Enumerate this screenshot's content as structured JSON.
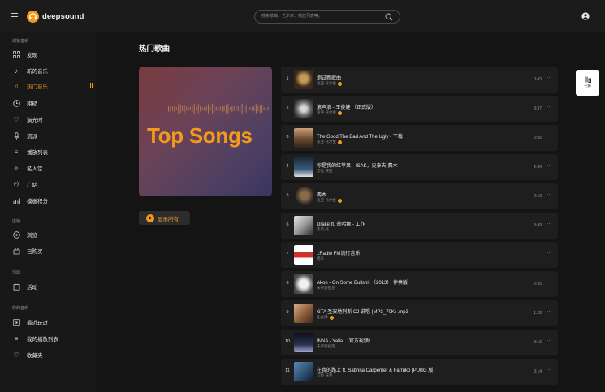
{
  "header": {
    "logo_text": "deepsound",
    "search_placeholder": "搜索歌曲、艺术家、播放列表等。"
  },
  "sidebar": {
    "sections": [
      {
        "title": "浏览音乐",
        "items": [
          {
            "label": "发现",
            "icon": "grid-icon"
          },
          {
            "label": "新的音乐",
            "icon": "music-note-icon"
          },
          {
            "label": "热门音乐",
            "icon": "fire-icon",
            "active": true
          },
          {
            "label": "粗糙",
            "icon": "clock-icon"
          },
          {
            "label": "演光时",
            "icon": "heart-icon"
          },
          {
            "label": "流派",
            "icon": "microphone-icon"
          },
          {
            "label": "播放列表",
            "icon": "playlist-icon"
          },
          {
            "label": "名人堂",
            "icon": "star-icon"
          },
          {
            "label": "广站",
            "icon": "radio-icon"
          },
          {
            "label": "模板积分",
            "icon": "chart-icon"
          }
        ]
      },
      {
        "title": "店铺",
        "items": [
          {
            "label": "浏览",
            "icon": "browse-icon"
          },
          {
            "label": "已购买",
            "icon": "bag-icon"
          }
        ]
      },
      {
        "title": "活动",
        "items": [
          {
            "label": "活动",
            "icon": "calendar-icon"
          }
        ]
      },
      {
        "title": "你的音乐",
        "items": [
          {
            "label": "最近玩过",
            "icon": "play-box-icon"
          },
          {
            "label": "我的播放列表",
            "icon": "list-icon"
          },
          {
            "label": "收藏夹",
            "icon": "heart-outline-icon"
          }
        ]
      }
    ]
  },
  "main": {
    "page_title": "热门歌曲",
    "cover_title": "Top Songs",
    "show_all_label": "显示所有",
    "float_label": "卡匣",
    "songs": [
      {
        "num": "1",
        "title": "测试新歌曲",
        "artist": "迪亚·托尔金",
        "verified": true,
        "duration": "0:43"
      },
      {
        "num": "2",
        "title": "滚声浪 - 王俊健 （正式版）",
        "artist": "迪亚·托尔金",
        "verified": true,
        "duration": "3:37"
      },
      {
        "num": "3",
        "title": "The Good The Bad And The Ugly - 下载",
        "artist": "迪亚·托尔金",
        "verified": true,
        "duration": "2:55"
      },
      {
        "num": "4",
        "title": "你是我的红苹果，ISAK，史泰夫·费木",
        "artist": "艾拉·沃西",
        "verified": false,
        "duration": "2:40"
      },
      {
        "num": "5",
        "title": "两本",
        "artist": "迪亚·托尔金",
        "verified": true,
        "duration": "2:19"
      },
      {
        "num": "6",
        "title": "Drake ft. 蕾哈娜 - 工作",
        "artist": "凯风·托",
        "verified": false,
        "duration": "3:49"
      },
      {
        "num": "7",
        "title": "1Radio FM流行音乐",
        "artist": "摇乐",
        "verified": false,
        "duration": ""
      },
      {
        "num": "8",
        "title": "Akon - On Some Bullshit （2013） 伴奏版",
        "artist": "未参雷拉克",
        "verified": false,
        "duration": "2:35"
      },
      {
        "num": "9",
        "title": "GTA 圣安地列斯 CJ 说唱 (MP3_70K) .mp3",
        "artist": "乱舍佛",
        "verified": true,
        "duration": "1:28"
      },
      {
        "num": "10",
        "title": "INNA - Yalla （官方视频）",
        "artist": "未参雷拉克",
        "verified": false,
        "duration": "3:16"
      },
      {
        "num": "11",
        "title": "在我的路上 ft. Sabrina Carpenter & Farruko [PUBG 版]",
        "artist": "艾拉·沃西",
        "verified": false,
        "duration": "3:14"
      }
    ]
  },
  "colors": {
    "accent": "#f39a1c",
    "background": "#141414",
    "row": "#1e1e1e"
  }
}
